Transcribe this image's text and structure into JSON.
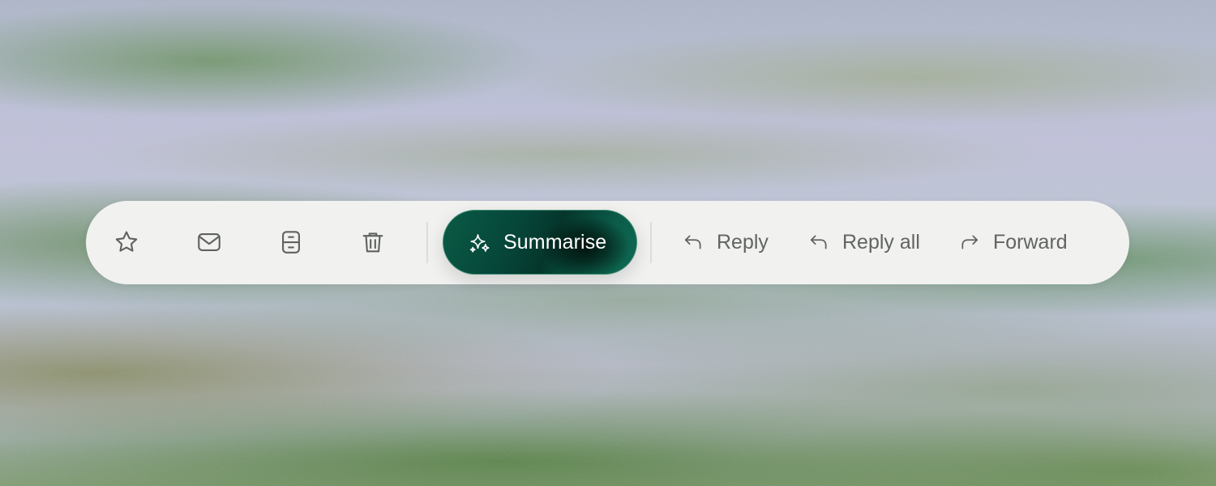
{
  "toolbar": {
    "icons": {
      "star": "star-icon",
      "mail": "mail-icon",
      "archive": "archive-icon",
      "trash": "trash-icon"
    },
    "summarise": {
      "label": "Summarise",
      "icon": "sparkle-icon"
    },
    "actions": {
      "reply": {
        "label": "Reply",
        "icon": "reply-icon"
      },
      "reply_all": {
        "label": "Reply all",
        "icon": "reply-all-icon"
      },
      "forward": {
        "label": "Forward",
        "icon": "forward-icon"
      }
    }
  },
  "colors": {
    "toolbar_bg": "#f1f1f0",
    "icon_gray": "#5f6360",
    "text_gray": "#616562",
    "accent_green": "#06473a"
  }
}
